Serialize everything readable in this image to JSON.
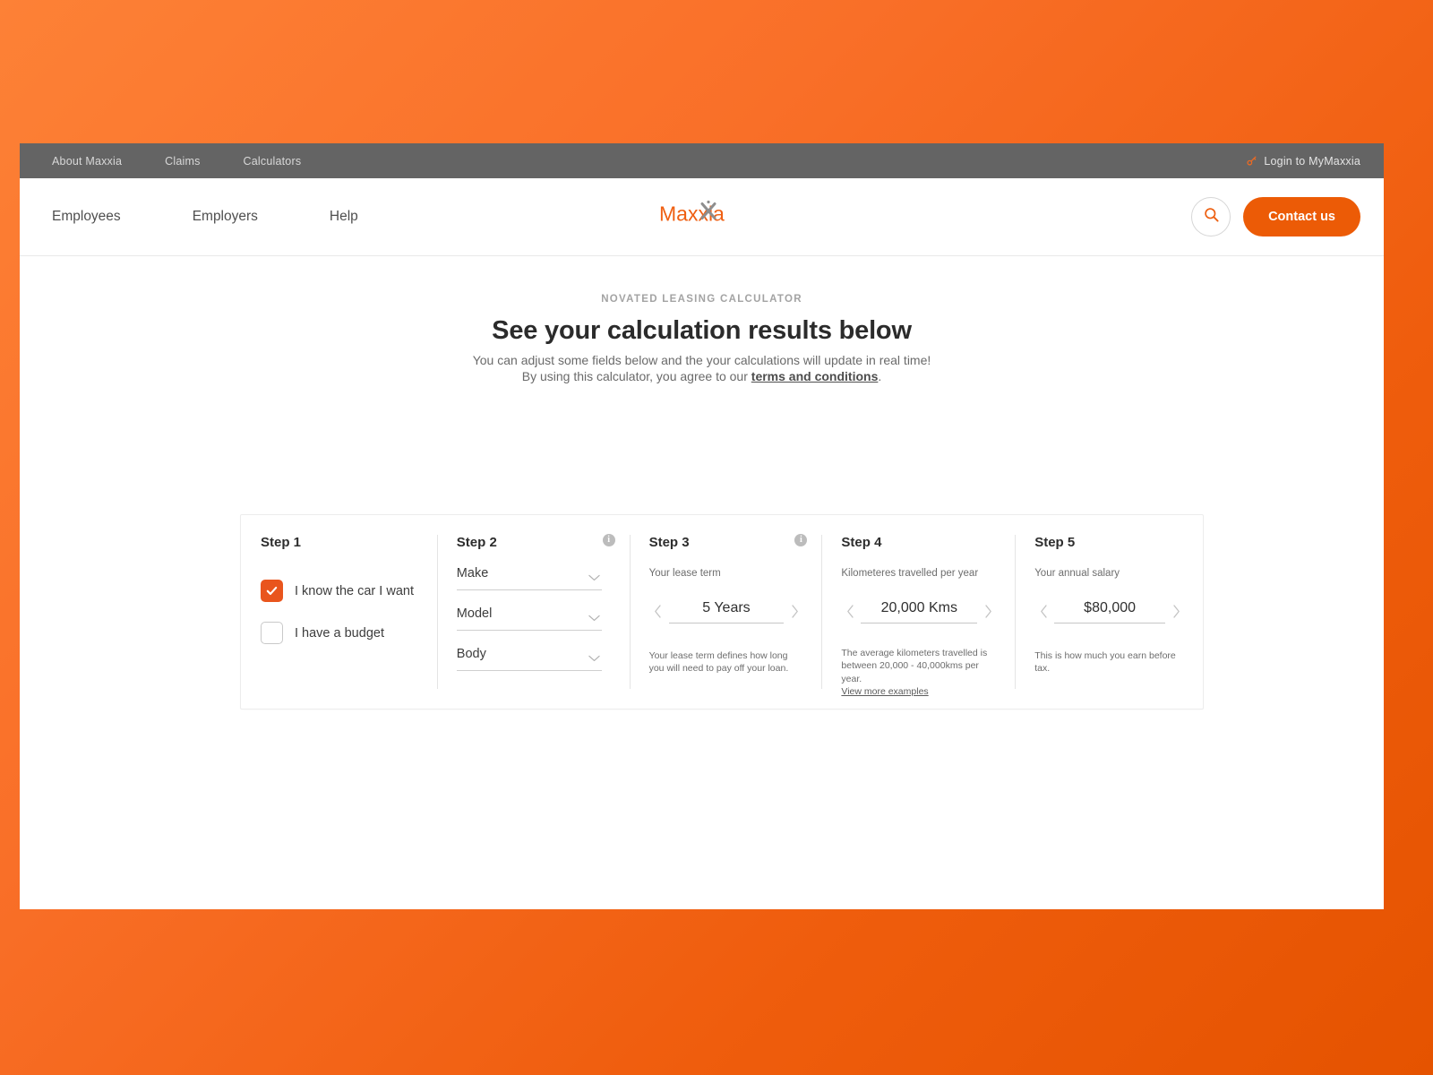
{
  "theme": {
    "brand_orange": "#ec5b06",
    "checkbox_orange": "#e9551d",
    "utility_bar_grey": "#646464",
    "background_gradient_from": "#fd8136",
    "background_gradient_to": "#e55300"
  },
  "utility_bar": {
    "links": [
      {
        "label": "About Maxxia"
      },
      {
        "label": "Claims"
      },
      {
        "label": "Calculators"
      }
    ],
    "login": {
      "icon": "key-icon",
      "label": "Login to MyMaxxia"
    }
  },
  "main_nav": {
    "links": [
      {
        "label": "Employees"
      },
      {
        "label": "Employers"
      },
      {
        "label": "Help"
      }
    ],
    "logo": {
      "text": "Maxxia",
      "icon": "maxxia-logo"
    },
    "search": {
      "icon": "search-icon"
    },
    "contact_button": {
      "label": "Contact us"
    }
  },
  "hero": {
    "eyebrow": "NOVATED LEASING CALCULATOR",
    "title": "See your calculation results below",
    "sub_line_1": "You can adjust some fields below and the your calculations will update in real time!",
    "sub_line_2_pre": "By using this calculator, you agree to our ",
    "sub_line_2_link": "terms and conditions",
    "sub_line_2_post": "."
  },
  "steps": {
    "step1": {
      "title": "Step 1",
      "options": [
        {
          "label": "I know the car I want",
          "checked": true
        },
        {
          "label": "I have a budget",
          "checked": false
        }
      ]
    },
    "step2": {
      "title": "Step 2",
      "info_icon": "info-icon",
      "fields": [
        {
          "label": "Make",
          "icon": "chevron-down-icon"
        },
        {
          "label": "Model",
          "icon": "chevron-down-icon"
        },
        {
          "label": "Body",
          "icon": "chevron-down-icon"
        }
      ]
    },
    "step3": {
      "title": "Step 3",
      "info_icon": "info-icon",
      "caption": "Your lease term",
      "value": "5 Years",
      "prev_icon": "chevron-left-icon",
      "next_icon": "chevron-right-icon",
      "help": "Your lease term defines how long you will need to pay off your loan."
    },
    "step4": {
      "title": "Step 4",
      "caption": "Kilometeres travelled per year",
      "value": "20,000 Kms",
      "prev_icon": "chevron-left-icon",
      "next_icon": "chevron-right-icon",
      "help": "The average kilometers travelled is between 20,000 - 40,000kms per year.",
      "help_link": "View more examples"
    },
    "step5": {
      "title": "Step 5",
      "caption": "Your annual salary",
      "value": "$80,000",
      "prev_icon": "chevron-left-icon",
      "next_icon": "chevron-right-icon",
      "help": "This is how much you earn before tax."
    }
  }
}
